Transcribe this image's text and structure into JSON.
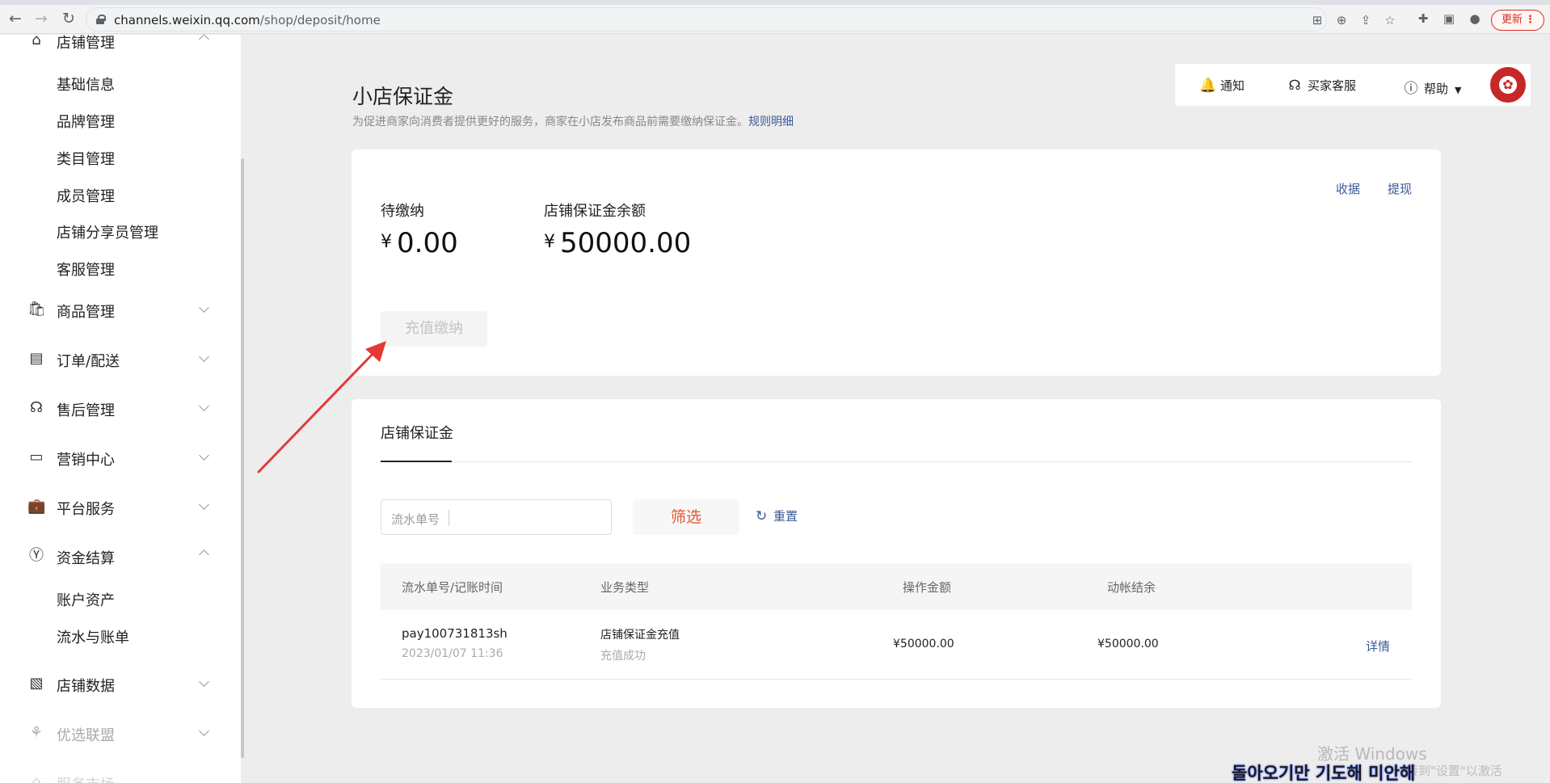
{
  "browser": {
    "url_host": "channels.weixin.qq.com",
    "url_path": "/shop/deposit/home",
    "update_label": "更新"
  },
  "sidebar": {
    "shop_manage": "店铺管理",
    "sub_shop": [
      "基础信息",
      "品牌管理",
      "类目管理",
      "成员管理",
      "店铺分享员管理",
      "客服管理"
    ],
    "goods": "商品管理",
    "orders": "订单/配送",
    "aftersale": "售后管理",
    "marketing": "营销中心",
    "platform": "平台服务",
    "finance": "资金结算",
    "sub_finance": [
      "账户资产",
      "流水与账单"
    ],
    "data": "店铺数据",
    "alliance": "优选联盟",
    "market": "服务市场"
  },
  "header": {
    "title": "小店保证金",
    "desc": "为促进商家向消费者提供更好的服务，商家在小店发布商品前需要缴纳保证金。",
    "rules_link": "规则明细"
  },
  "topbar": {
    "notify": "通知",
    "service": "买家客服",
    "help": "帮助"
  },
  "deposit": {
    "pending_label": "待缴纳",
    "pending_value": "0.00",
    "balance_label": "店铺保证金余额",
    "balance_value": "50000.00",
    "currency": "¥",
    "receipt": "收据",
    "withdraw": "提现",
    "recharge": "充值缴纳"
  },
  "records": {
    "tab": "店铺保证金",
    "search_placeholder": "流水单号",
    "filter": "筛选",
    "reset": "重置",
    "columns": [
      "流水单号/记账时间",
      "业务类型",
      "操作金额",
      "动帐结余"
    ],
    "rows": [
      {
        "id": "pay100731813sh",
        "time": "2023/01/07 11:36",
        "type": "店铺保证金充值",
        "status": "充值成功",
        "amount": "¥50000.00",
        "balance": "¥50000.00",
        "action": "详情"
      }
    ]
  },
  "watermark": {
    "line1": "激活 Windows",
    "line2": "转到\"设置\"以激活 Windows。",
    "overlay": "돌아오기만 기도해 미안해"
  }
}
